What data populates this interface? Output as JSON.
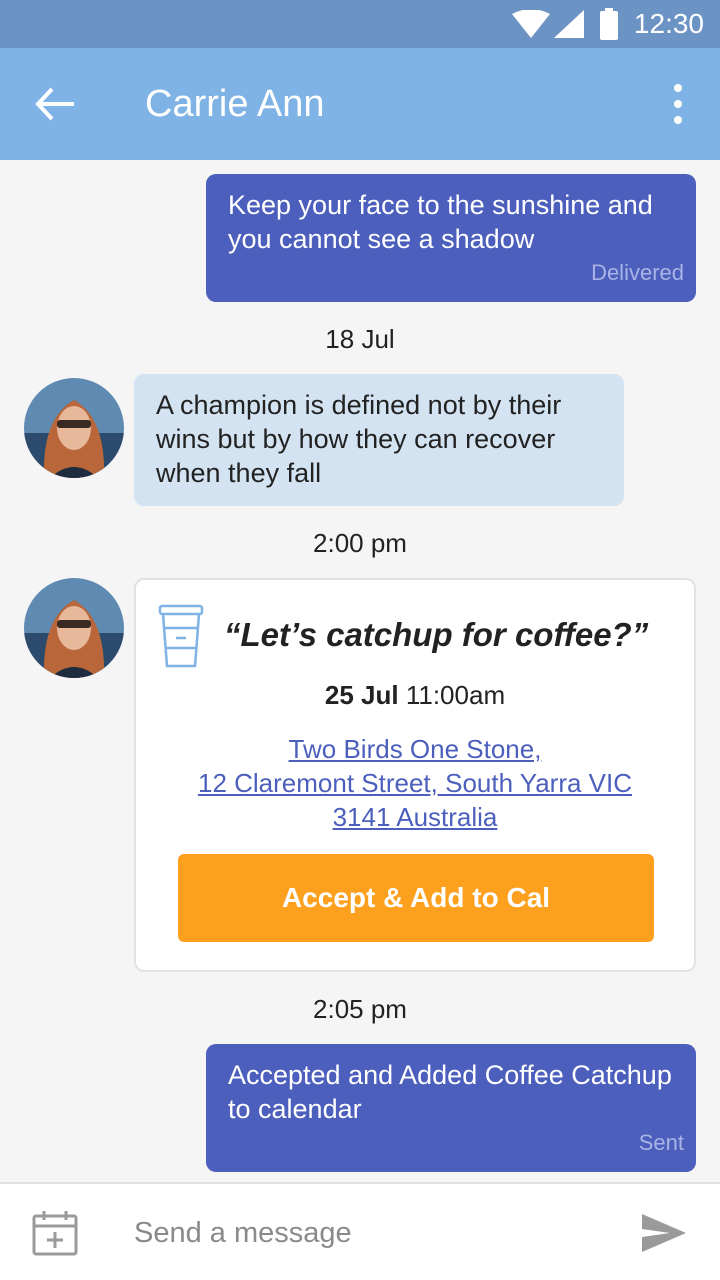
{
  "status_bar": {
    "time": "12:30"
  },
  "header": {
    "title": "Carrie Ann"
  },
  "messages": {
    "m1": {
      "text": "Keep your face to the sunshine and you cannot see a shadow",
      "status": "Delivered"
    },
    "stamp1": "18 Jul",
    "m2": {
      "text": "A champion is defined not by their wins but by how they can recover when they fall"
    },
    "stamp2": "2:00 pm",
    "invite": {
      "title": "“Let’s catchup for coffee?”",
      "date": "25 Jul",
      "time": "11:00am",
      "address_line1": "Two Birds One Stone,",
      "address_line2": "12 Claremont Street, South Yarra VIC",
      "address_line3": "3141 Australia",
      "accept_label": "Accept & Add to Cal"
    },
    "stamp3": "2:05 pm",
    "m3": {
      "text": "Accepted and Added Coffee Catchup to calendar",
      "status": "Sent"
    }
  },
  "composer": {
    "placeholder": "Send a message"
  },
  "colors": {
    "app_bar": "#7fb2e5",
    "outgoing": "#4c5fbd",
    "incoming": "#d3e3f1",
    "accept": "#fda01e"
  }
}
